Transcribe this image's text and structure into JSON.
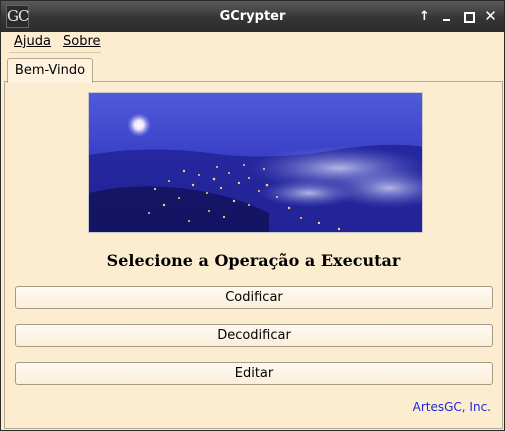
{
  "window": {
    "title": "GCrypter",
    "logo_text": "GC",
    "controls": [
      "up-arrow-icon",
      "minimize-icon",
      "maximize-icon",
      "close-icon"
    ]
  },
  "menu": {
    "items": [
      {
        "label": "Ajuda"
      },
      {
        "label": "Sobre"
      }
    ]
  },
  "tabs": [
    {
      "label": "Bem-Vindo"
    }
  ],
  "main": {
    "heading": "Selecione a Operação a Executar",
    "buttons": [
      {
        "label": "Codificar"
      },
      {
        "label": "Decodificar"
      },
      {
        "label": "Editar"
      }
    ],
    "footer_link": "ArtesGC, Inc."
  },
  "colors": {
    "accent": "#1f27d6",
    "background": "#fdedd0",
    "titlebar": "#353535"
  }
}
